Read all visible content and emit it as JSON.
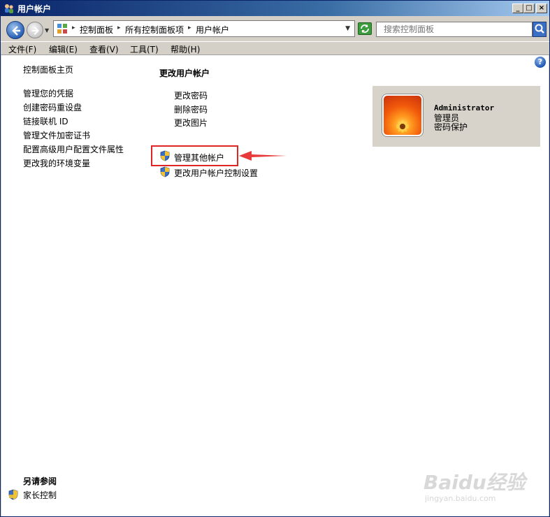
{
  "window": {
    "title": "用户帐户"
  },
  "caption_buttons": {
    "minimize": "_",
    "maximize": "□",
    "close": "×"
  },
  "address": {
    "crumbs": [
      "控制面板",
      "所有控制面板项",
      "用户帐户"
    ],
    "search_placeholder": "搜索控制面板"
  },
  "menu": [
    "文件(F)",
    "编辑(E)",
    "查看(V)",
    "工具(T)",
    "帮助(H)"
  ],
  "sidebar": {
    "home": "控制面板主页",
    "links": [
      "管理您的凭据",
      "创建密码重设盘",
      "链接联机 ID",
      "管理文件加密证书",
      "配置高级用户配置文件属性",
      "更改我的环境变量"
    ],
    "see_also_heading": "另请参阅",
    "see_also_link": "家长控制"
  },
  "main": {
    "heading": "更改用户帐户",
    "links": [
      "更改密码",
      "删除密码",
      "更改图片"
    ],
    "admin_links": [
      "管理其他帐户",
      "更改用户帐户控制设置"
    ]
  },
  "user": {
    "name": "Administrator",
    "role": "管理员",
    "status": "密码保护"
  },
  "watermark": {
    "brand": "Baidu经验",
    "url": "jingyan.baidu.com"
  },
  "colors": {
    "title_bar": "#0a246a",
    "highlight": "#e02525",
    "panel": "#d7d3cb"
  }
}
